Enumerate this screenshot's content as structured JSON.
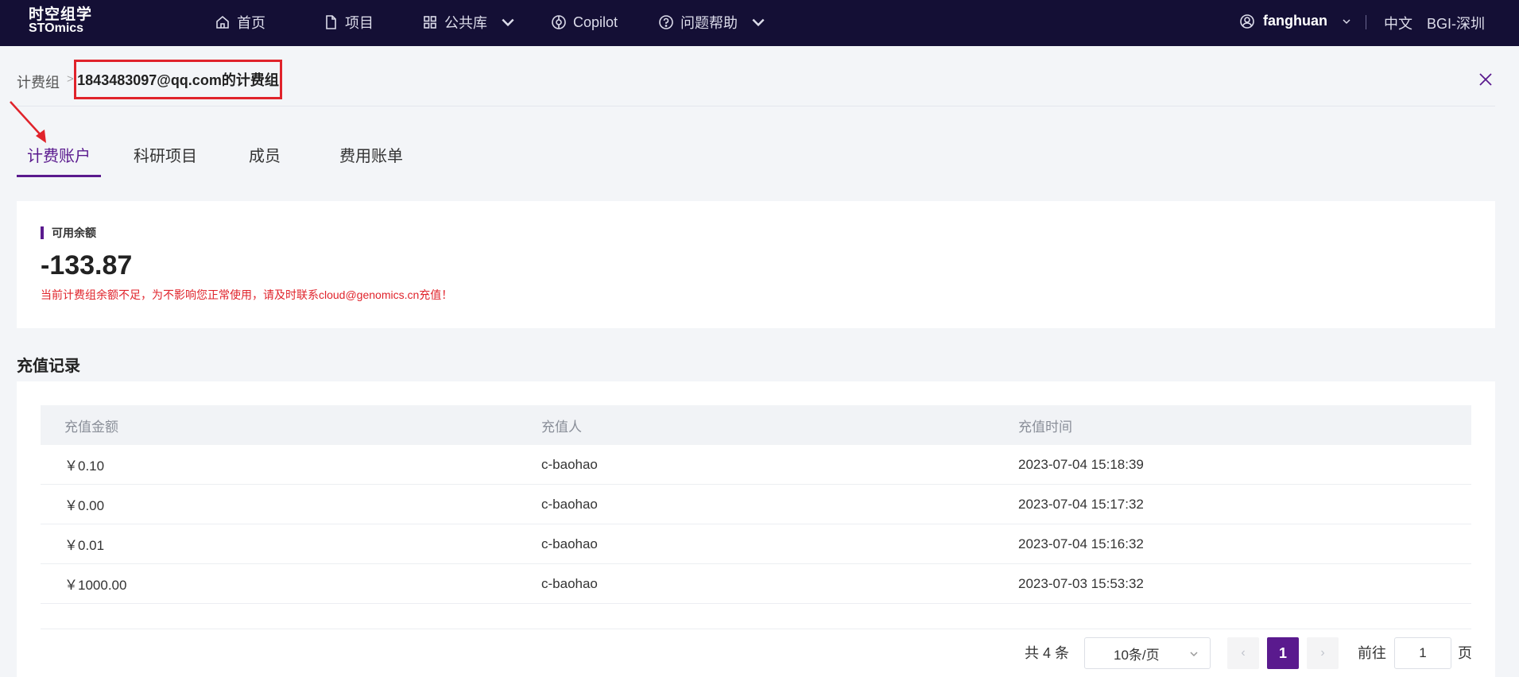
{
  "header": {
    "logo_cn": "时空组学",
    "logo_en": "STOmics",
    "nav": {
      "home": "首页",
      "projects": "项目",
      "public_lib": "公共库",
      "copilot": "Copilot",
      "help": "问题帮助"
    },
    "user": "fanghuan",
    "language": "中文",
    "region": "BGI-深圳"
  },
  "breadcrumb": {
    "root": "计费组",
    "separator": ">",
    "current": "1843483097@qq.com的计费组"
  },
  "tabs": [
    "计费账户",
    "科研项目",
    "成员",
    "费用账单"
  ],
  "active_tab": "计费账户",
  "balance": {
    "label": "可用余额",
    "value": "-133.87",
    "warning": "当前计费组余额不足，为不影响您正常使用，请及时联系cloud@genomics.cn充值！"
  },
  "records": {
    "title": "充值记录",
    "columns": [
      "充值金额",
      "充值人",
      "充值时间"
    ],
    "rows": [
      {
        "amount": "￥0.10",
        "user": "c-baohao",
        "time": "2023-07-04 15:18:39"
      },
      {
        "amount": "￥0.00",
        "user": "c-baohao",
        "time": "2023-07-04 15:17:32"
      },
      {
        "amount": "￥0.01",
        "user": "c-baohao",
        "time": "2023-07-04 15:16:32"
      },
      {
        "amount": "￥1000.00",
        "user": "c-baohao",
        "time": "2023-07-03 15:53:32"
      }
    ]
  },
  "pagination": {
    "total": "共 4 条",
    "page_size": "10条/页",
    "prev": "‹",
    "next": "›",
    "current_page": "1",
    "goto_label": "前往",
    "goto_value": "1",
    "page_unit": "页"
  },
  "colors": {
    "nav_bg": "#140f35",
    "accent": "#5a1a8e",
    "warning": "#e0232b"
  }
}
